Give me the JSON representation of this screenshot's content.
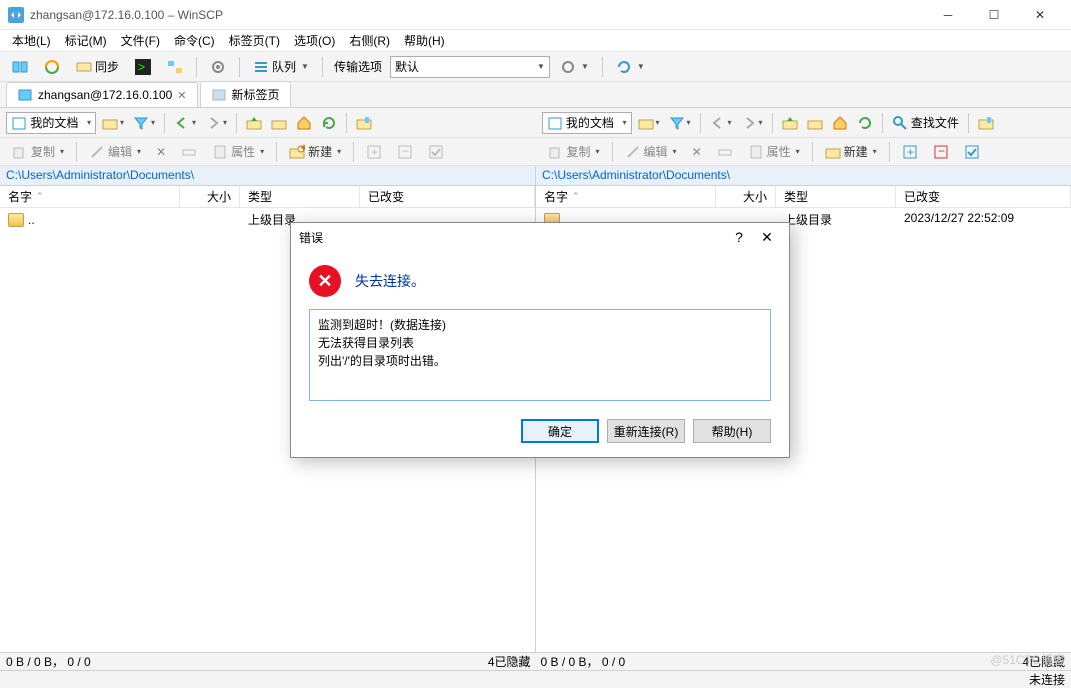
{
  "window": {
    "title": "zhangsan@172.16.0.100 – WinSCP"
  },
  "menus": {
    "local": "本地(L)",
    "mark": "标记(M)",
    "file": "文件(F)",
    "cmd": "命令(C)",
    "tab": "标签页(T)",
    "options": "选项(O)",
    "remote": "右侧(R)",
    "help": "帮助(H)"
  },
  "toolbar": {
    "sync": "同步",
    "queue": "队列",
    "transfer_label": "传输选项",
    "transfer_preset": "默认"
  },
  "tabs": {
    "session": "zhangsan@172.16.0.100",
    "new": "新标签页"
  },
  "nav": {
    "location": "我的文档",
    "find": "查找文件"
  },
  "ops": {
    "copy": "复制",
    "edit": "编辑",
    "props": "属性",
    "new": "新建"
  },
  "left": {
    "path": "C:\\Users\\Administrator\\Documents\\",
    "cols": {
      "name": "名字",
      "size": "大小",
      "type": "类型",
      "changed": "已改变"
    },
    "row0": {
      "name": "..",
      "type": "上级目录",
      "changed": ""
    }
  },
  "right": {
    "path": "C:\\Users\\Administrator\\Documents\\",
    "cols": {
      "name": "名字",
      "size": "大小",
      "type": "类型",
      "changed": "已改变"
    },
    "row0": {
      "name": "..",
      "type": "上级目录",
      "changed": "2023/12/27 22:52:09"
    }
  },
  "status": {
    "left": "0 B / 0 B， 0 / 0",
    "left_hidden": "4已隐藏",
    "right": "0 B / 0 B， 0 / 0",
    "right_hidden": "4已隐藏",
    "conn": "未连接"
  },
  "dialog": {
    "title": "错误",
    "heading": "失去连接。",
    "body": "监测到超时！(数据连接)\n无法获得目录列表\n列出'/'的目录项时出错。",
    "ok": "确定",
    "reconnect": "重新连接(R)",
    "help": "帮助(H)"
  },
  "watermark": "@51CTO博客"
}
